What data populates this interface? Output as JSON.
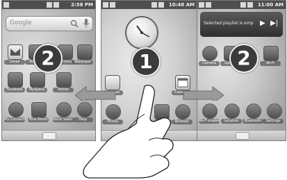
{
  "left_screen": {
    "status_time": "2:58 PM",
    "search_text": "Google",
    "badge": "2",
    "apps": [
      {
        "label": "Gmail"
      },
      {
        "label": "Market"
      },
      {
        "label": "Camera"
      },
      {
        "label": "Wallpaper"
      },
      {
        "label": "Facebook"
      },
      {
        "label": "MySpace"
      },
      {
        "label": "Twitter"
      },
      {
        "label": "..."
      },
      {
        "label": "My Contacts"
      },
      {
        "label": "Tone Room"
      },
      {
        "label": "Voice Search"
      },
      {
        "label": "Help"
      }
    ]
  },
  "center_screen": {
    "status_time": "10:48 AM",
    "badge": "1",
    "apps": [
      {
        "label": "Pictures"
      },
      {
        "label": "Calendar"
      },
      {
        "label": "Phone"
      },
      {
        "label": "Messaging"
      },
      {
        "label": "Browser"
      }
    ]
  },
  "right_screen": {
    "status_time": "11:00 AM",
    "badge": "2",
    "widget_text": "Selected playlist is emp",
    "apps": [
      {
        "label": "Camera"
      },
      {
        "label": "Gallery"
      },
      {
        "label": "Wi-Fi"
      },
      {
        "label": "Wi-Fi enabler"
      },
      {
        "label": "Location"
      },
      {
        "label": "Bluetooth"
      },
      {
        "label": "Settings"
      }
    ]
  },
  "colors": {
    "badge_bg": "#3b3b3b",
    "arrow_fill": "#9a9a9a",
    "status_bar": "#4e4e4e"
  }
}
